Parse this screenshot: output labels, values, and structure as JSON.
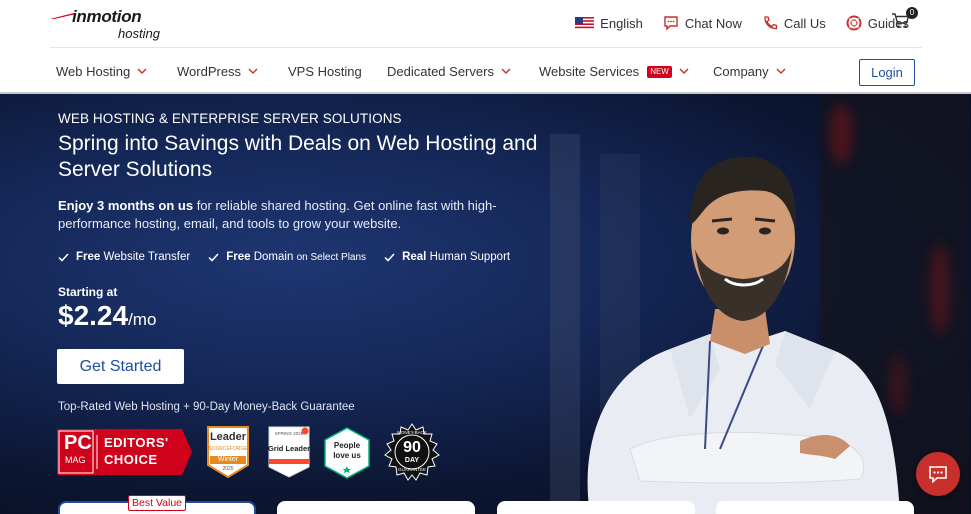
{
  "brand": {
    "name": "inmotion",
    "sub": "hosting"
  },
  "utility": {
    "language": "English",
    "chat": "Chat Now",
    "call": "Call Us",
    "guides": "Guides",
    "cart_count": "0"
  },
  "nav": {
    "items": [
      {
        "label": "Web Hosting",
        "dropdown": true
      },
      {
        "label": "WordPress",
        "dropdown": true
      },
      {
        "label": "VPS Hosting",
        "dropdown": false
      },
      {
        "label": "Dedicated Servers",
        "dropdown": true
      },
      {
        "label": "Website Services",
        "dropdown": true,
        "badge": "NEW"
      },
      {
        "label": "Company",
        "dropdown": true
      }
    ],
    "login": "Login"
  },
  "hero": {
    "eyebrow": "WEB HOSTING & ENTERPRISE SERVER SOLUTIONS",
    "headline": "Spring into Savings with Deals on Web Hosting and Server Solutions",
    "sub_bold": "Enjoy 3 months on us",
    "sub_rest": " for reliable shared hosting. Get online fast with high-performance hosting, email, and tools to grow your website.",
    "checks": [
      {
        "bold": "Free",
        "text": "Website Transfer",
        "small": ""
      },
      {
        "bold": "Free",
        "text": "Domain",
        "small": "on Select Plans"
      },
      {
        "bold": "Real",
        "text": "Human Support",
        "small": ""
      }
    ],
    "starting_at": "Starting at",
    "price": "$2.24",
    "per": "/mo",
    "cta": "Get Started",
    "guarantee": "Top-Rated Web Hosting + 90-Day Money-Back Guarantee",
    "awards": {
      "pcmag_logo": "PC",
      "pcmag_sub": "MAG",
      "pcmag_line1": "EDITORS'",
      "pcmag_line2": "CHOICE",
      "sf_title": "Leader",
      "sf_source": "SOURCEFORGE",
      "sf_season": "Winter",
      "sf_year": "2025",
      "g2_top": "SPRING 2025",
      "g2_title": "Grid Leader",
      "tp_line1": "People",
      "tp_line2": "love us",
      "mb_top": "MONEY-BACK",
      "mb_num": "90",
      "mb_day": "DAY",
      "mb_bottom": "GUARANTEE"
    }
  },
  "cards": {
    "best_value": "Best Value"
  },
  "colors": {
    "accent": "#1d4e9e",
    "brand_red": "#d0021b",
    "hero_bg": "#142757",
    "chat": "#c8302d"
  }
}
